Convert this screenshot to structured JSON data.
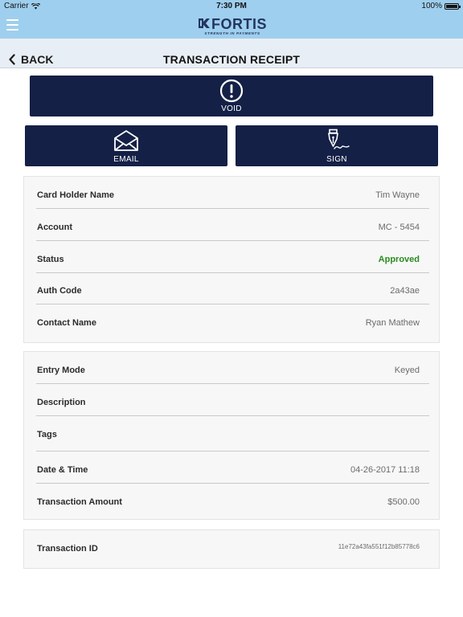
{
  "status_bar": {
    "carrier": "Carrier",
    "time": "7:30 PM",
    "battery": "100%"
  },
  "header": {
    "logo_text": "FORTIS",
    "logo_tagline": "STRENGTH IN PAYMENTS",
    "brand_color": "#23365f",
    "header_color": "#9fcfee"
  },
  "nav": {
    "back_label": "BACK",
    "title": "TRANSACTION RECEIPT"
  },
  "actions": {
    "void_label": "VOID",
    "email_label": "EMAIL",
    "sign_label": "SIGN",
    "button_color": "#142046"
  },
  "details": {
    "card_holder_label": "Card Holder Name",
    "card_holder_value": "Tim Wayne",
    "account_label": "Account",
    "account_value": "MC - 5454",
    "status_label": "Status",
    "status_value": "Approved",
    "status_color": "#2a8b1f",
    "auth_code_label": "Auth Code",
    "auth_code_value": "2a43ae",
    "contact_label": "Contact Name",
    "contact_value": "Ryan Mathew"
  },
  "more_details": {
    "entry_mode_label": "Entry Mode",
    "entry_mode_value": "Keyed",
    "description_label": "Description",
    "description_value": "",
    "tags_label": "Tags",
    "tags_value": "",
    "datetime_label": "Date & Time",
    "datetime_value": "04-26-2017 11:18",
    "amount_label": "Transaction Amount",
    "amount_value": "$500.00"
  },
  "transaction": {
    "id_label": "Transaction ID",
    "id_value": "11e72a43fa551f12b85778c6"
  }
}
